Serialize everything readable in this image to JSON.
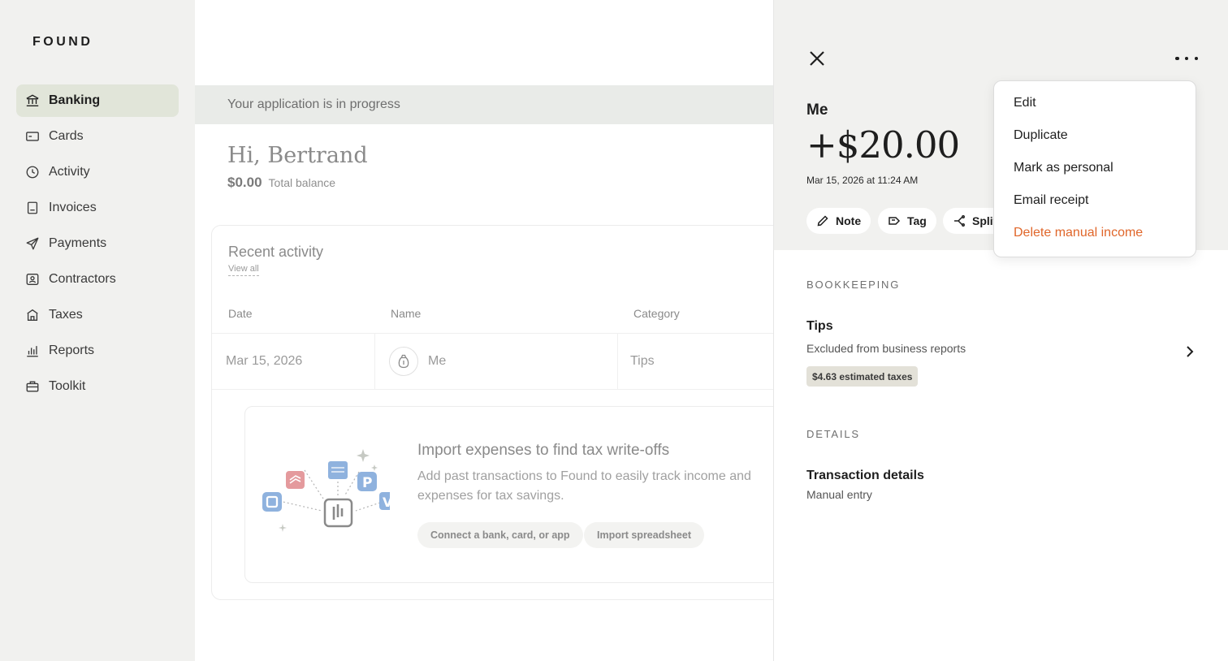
{
  "app": {
    "logo": "FOUND"
  },
  "sidebar": {
    "items": [
      {
        "label": "Banking",
        "icon": "bank-icon",
        "active": true
      },
      {
        "label": "Cards",
        "icon": "card-icon"
      },
      {
        "label": "Activity",
        "icon": "clock-icon"
      },
      {
        "label": "Invoices",
        "icon": "invoice-icon"
      },
      {
        "label": "Payments",
        "icon": "send-icon"
      },
      {
        "label": "Contractors",
        "icon": "contractor-icon"
      },
      {
        "label": "Taxes",
        "icon": "taxes-icon"
      },
      {
        "label": "Reports",
        "icon": "chart-icon"
      },
      {
        "label": "Toolkit",
        "icon": "toolkit-icon"
      }
    ]
  },
  "main": {
    "banner": "Your application is in progress",
    "greeting": "Hi, Bertrand",
    "balance_amount": "$0.00",
    "balance_label": "Total balance",
    "activity": {
      "title": "Recent activity",
      "view_all": "View all",
      "columns": [
        "Date",
        "Name",
        "Category"
      ],
      "rows": [
        {
          "date": "Mar 15, 2026",
          "name": "Me",
          "category": "Tips"
        }
      ]
    },
    "import": {
      "title": "Import expenses to find tax write-offs",
      "subtitle": "Add past transactions to Found to easily track income and expenses for tax savings.",
      "connect_label": "Connect a bank, card, or app",
      "spreadsheet_label": "Import spreadsheet"
    }
  },
  "panel": {
    "payee": "Me",
    "amount": "+$20.00",
    "date": "Mar 15, 2026 at 11:24 AM",
    "actions": {
      "note": "Note",
      "tag": "Tag",
      "split": "Split"
    },
    "bookkeeping": {
      "heading": "BOOKKEEPING",
      "title": "Tips",
      "subtitle": "Excluded from business reports",
      "badge": "$4.63 estimated taxes"
    },
    "details": {
      "heading": "DETAILS",
      "title": "Transaction details",
      "subtitle": "Manual entry"
    }
  },
  "menu": {
    "items": [
      "Edit",
      "Duplicate",
      "Mark as personal",
      "Email receipt",
      "Delete manual income"
    ]
  },
  "colors": {
    "accent_active": "#e1e5d9",
    "danger": "#e0662a",
    "panel_bg": "#f1f1ef"
  }
}
